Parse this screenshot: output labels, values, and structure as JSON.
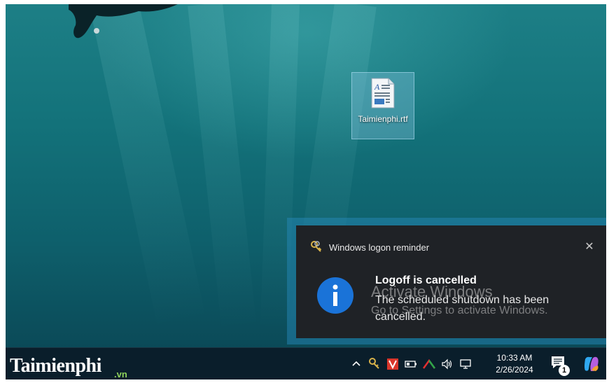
{
  "desktop": {
    "file_icon": {
      "label": "Taimienphi.rtf",
      "icon": "rtf-document-icon"
    }
  },
  "toast": {
    "app_name": "Windows logon reminder",
    "app_icon": "keys-icon",
    "close_glyph": "✕",
    "title": "Logoff is cancelled",
    "body": "The scheduled shutdown has been cancelled.",
    "info_glyph": "i",
    "accent_color": "#1a73d8"
  },
  "watermark": {
    "title": "Activate Windows",
    "subtitle": "Go to Settings to activate Windows."
  },
  "taskbar": {
    "brand_text": "Taimienphi",
    "brand_suffix": ".vn",
    "tray_icons": [
      "chevron-up-icon",
      "keys-icon",
      "v-app-icon",
      "battery-icon",
      "red-arrow-icon",
      "speaker-icon",
      "network-icon"
    ],
    "tray_chevron": "^",
    "time": "10:33 AM",
    "date": "2/26/2024",
    "notification_count": "1",
    "brand_color": "#8fd25b"
  }
}
